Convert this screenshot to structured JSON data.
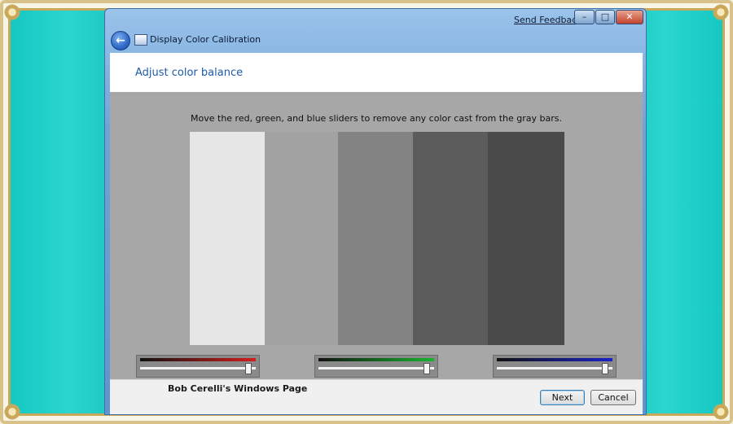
{
  "window": {
    "title": "Display Color Calibration",
    "feedback_link": "Send Feedback",
    "controls": {
      "minimize": "–",
      "maximize": "□",
      "close": "✕"
    },
    "back_glyph": "←"
  },
  "page": {
    "title": "Adjust color balance",
    "instruction": "Move the red, green, and blue sliders to remove any color cast from the gray bars."
  },
  "gray_bars": [
    "#e6e6e6",
    "#a2a2a2",
    "#838383",
    "#5c5c5c",
    "#4a4a4a"
  ],
  "sliders": [
    {
      "channel": "red",
      "color": "#d21e1e",
      "level": 0.97
    },
    {
      "channel": "green",
      "color": "#18b52e",
      "level": 0.97
    },
    {
      "channel": "blue",
      "color": "#1a22c8",
      "level": 0.97
    }
  ],
  "footer": {
    "credit": "Bob Cerelli's Windows Page",
    "next_label": "Next",
    "cancel_label": "Cancel"
  }
}
